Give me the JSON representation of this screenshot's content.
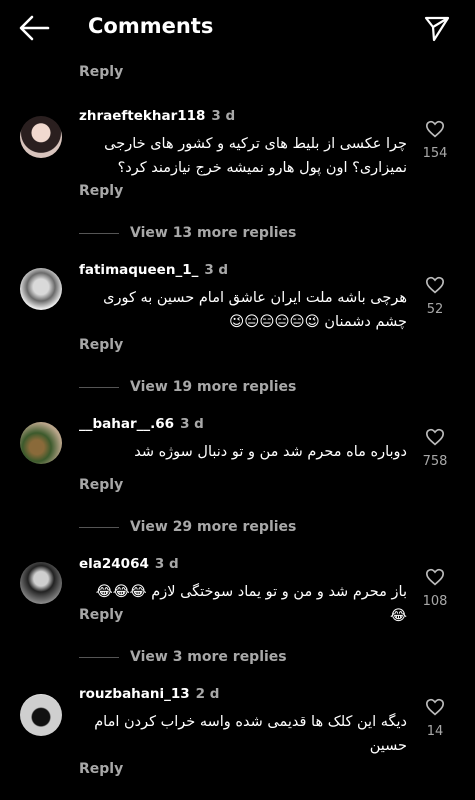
{
  "header": {
    "title": "Comments"
  },
  "reply_label": "Reply",
  "comments": [
    {
      "username": "zhraeftekhar118",
      "time": "3 d",
      "text": "چرا عکسی از بلیط های ترکیه و کشور های خارجی نمیزاری؟ اون پول هارو نمیشه خرج نیازمند کرد؟",
      "likes": "154",
      "view_more": "View 13 more replies"
    },
    {
      "username": "fatimaqueen_1_",
      "time": "3 d",
      "text": "هرچی باشه ملت ایران عاشق امام حسین به کوری چشم دشمنان 😉😑😑😑😑😉",
      "likes": "52",
      "view_more": "View 19 more replies"
    },
    {
      "username": "__bahar__.66",
      "time": "3 d",
      "text": "دوباره ماه محرم شد من و تو دنبال سوژه شد",
      "likes": "758",
      "view_more": "View 29 more replies"
    },
    {
      "username": "ela24064",
      "time": "3 d",
      "text": "باز محرم شد و من و تو یماد سوختگی لازم 😂😂😂😂",
      "likes": "108",
      "view_more": "View 3 more replies"
    },
    {
      "username": "rouzbahani_13",
      "time": "2 d",
      "text": "دیگه این کلک ها قدیمی شده واسه خراب کردن امام حسین",
      "likes": "14"
    }
  ]
}
